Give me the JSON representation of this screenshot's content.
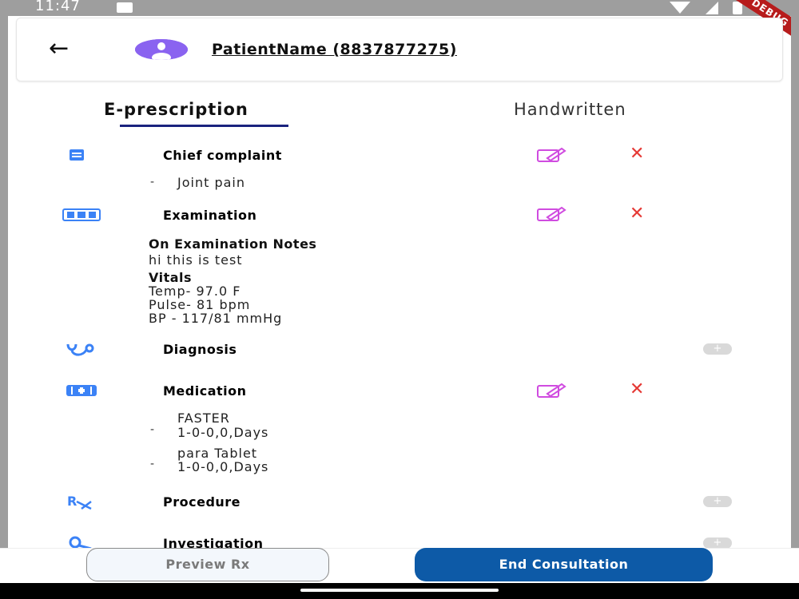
{
  "status_bar": {
    "time": "11:47",
    "debug": "DEBUG"
  },
  "header": {
    "back_icon": "arrow-left-icon",
    "avatar_icon": "person-icon",
    "patient_name": "PatientName (8837877275)"
  },
  "tabs": [
    {
      "label": "E-prescription",
      "active": true
    },
    {
      "label": "Handwritten",
      "active": false
    }
  ],
  "sections": {
    "chief_complaint": {
      "title": "Chief complaint",
      "icon": "clipboard-icon",
      "items": [
        "Joint pain"
      ]
    },
    "examination": {
      "title": "Examination",
      "icon": "examination-icon",
      "notes_heading": "On Examination Notes",
      "notes": "hi this is test",
      "vitals_heading": "Vitals",
      "vitals": [
        "Temp-  97.0 F",
        "Pulse-  81 bpm",
        "BP -  117/81 mmHg"
      ]
    },
    "diagnosis": {
      "title": "Diagnosis",
      "icon": "stethoscope-icon"
    },
    "medication": {
      "title": "Medication",
      "icon": "medical-kit-icon",
      "items": [
        {
          "name": "FASTER",
          "dosage": "1-0-0,0,Days"
        },
        {
          "name": "para Tablet",
          "dosage": "1-0-0,0,Days"
        }
      ]
    },
    "procedure": {
      "title": "Procedure",
      "icon": "rx-icon"
    },
    "investigation": {
      "title": "Investigation",
      "icon": "microscope-icon"
    }
  },
  "actions": {
    "edit_icon": "edit-icon",
    "delete_icon": "close-icon",
    "add_icon": "plus-icon",
    "delete_glyph": "✕",
    "add_glyph": "+"
  },
  "buttons": {
    "preview": "Preview Rx",
    "end": "End Consultation"
  },
  "colors": {
    "accent_blue": "#0d5aa7",
    "tab_underline": "#1a237e",
    "edit_purple": "#d04ce0",
    "delete_red": "#e53935",
    "icon_blue": "#3b82f6",
    "avatar_purple": "#8a63f0"
  }
}
